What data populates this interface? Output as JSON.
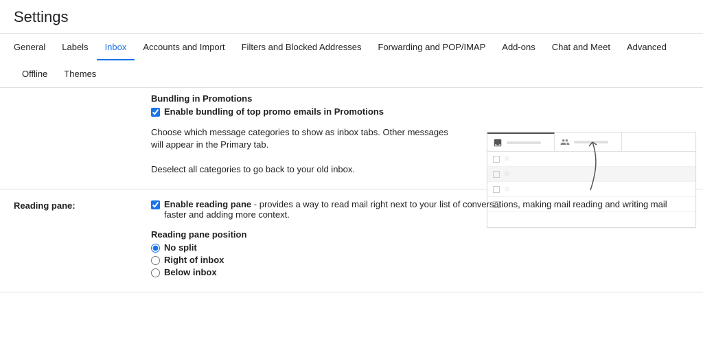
{
  "page_title": "Settings",
  "tabs": [
    "General",
    "Labels",
    "Inbox",
    "Accounts and Import",
    "Filters and Blocked Addresses",
    "Forwarding and POP/IMAP",
    "Add-ons",
    "Chat and Meet",
    "Advanced",
    "Offline",
    "Themes"
  ],
  "active_tab": "Inbox",
  "bundling": {
    "heading": "Bundling in Promotions",
    "checkbox_label": "Enable bundling of top promo emails in Promotions",
    "desc1": "Choose which message categories to show as inbox tabs. Other messages will appear in the Primary tab.",
    "desc2": "Deselect all categories to go back to your old inbox."
  },
  "reading_pane": {
    "label": "Reading pane:",
    "enable_label": "Enable reading pane",
    "enable_desc": " - provides a way to read mail right next to your list of conversations, making mail reading and writing mail faster and adding more context.",
    "position_heading": "Reading pane position",
    "options": [
      "No split",
      "Right of inbox",
      "Below inbox"
    ],
    "selected": "No split"
  }
}
